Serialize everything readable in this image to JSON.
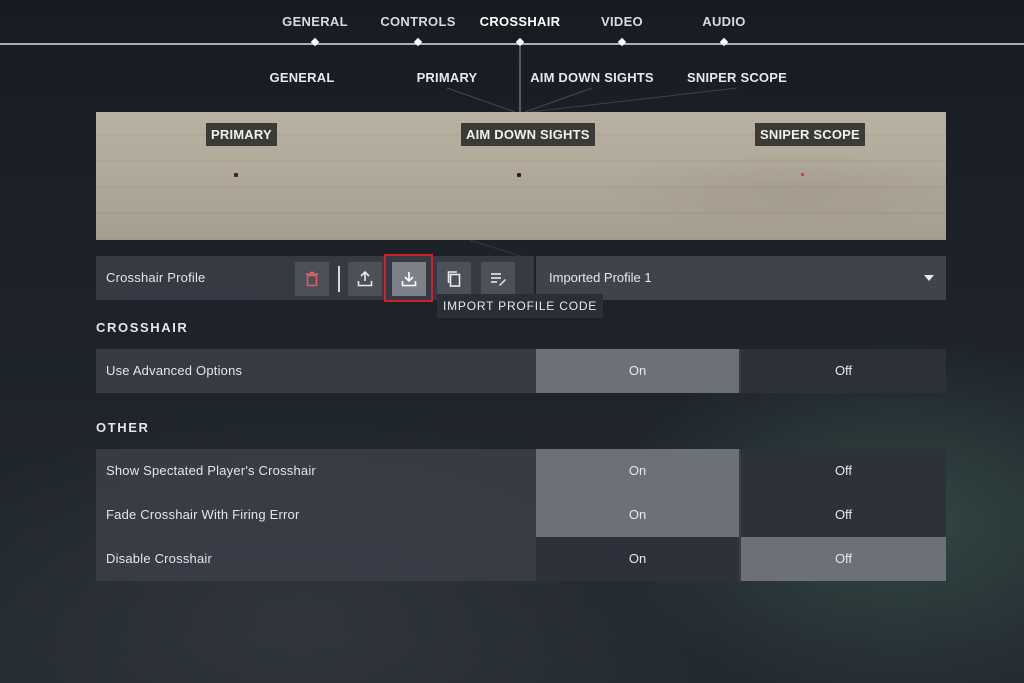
{
  "top_nav": {
    "items": [
      "GENERAL",
      "CONTROLS",
      "CROSSHAIR",
      "VIDEO",
      "AUDIO"
    ],
    "active": "CROSSHAIR"
  },
  "sub_nav": {
    "items": [
      "GENERAL",
      "PRIMARY",
      "AIM DOWN SIGHTS",
      "SNIPER SCOPE"
    ]
  },
  "preview": {
    "labels": [
      "PRIMARY",
      "AIM DOWN SIGHTS",
      "SNIPER SCOPE"
    ],
    "crosshair_colors": [
      "#4a2020",
      "#3a1a1a",
      "#e23030"
    ]
  },
  "profile_row": {
    "label": "Crosshair Profile",
    "icons": [
      "trash-icon",
      "export-icon",
      "import-icon",
      "copy-icon",
      "rename-icon"
    ],
    "selected_profile": "Imported Profile 1",
    "tooltip": "IMPORT PROFILE CODE",
    "highlight_color": "#d0202a"
  },
  "sections": {
    "crosshair": {
      "title": "CROSSHAIR",
      "rows": [
        {
          "label": "Use Advanced Options",
          "on": "On",
          "off": "Off",
          "value": "On"
        }
      ]
    },
    "other": {
      "title": "OTHER",
      "rows": [
        {
          "label": "Show Spectated Player's Crosshair",
          "on": "On",
          "off": "Off",
          "value": "On"
        },
        {
          "label": "Fade Crosshair With Firing Error",
          "on": "On",
          "off": "Off",
          "value": "On"
        },
        {
          "label": "Disable Crosshair",
          "on": "On",
          "off": "Off",
          "value": "Off"
        }
      ]
    }
  }
}
